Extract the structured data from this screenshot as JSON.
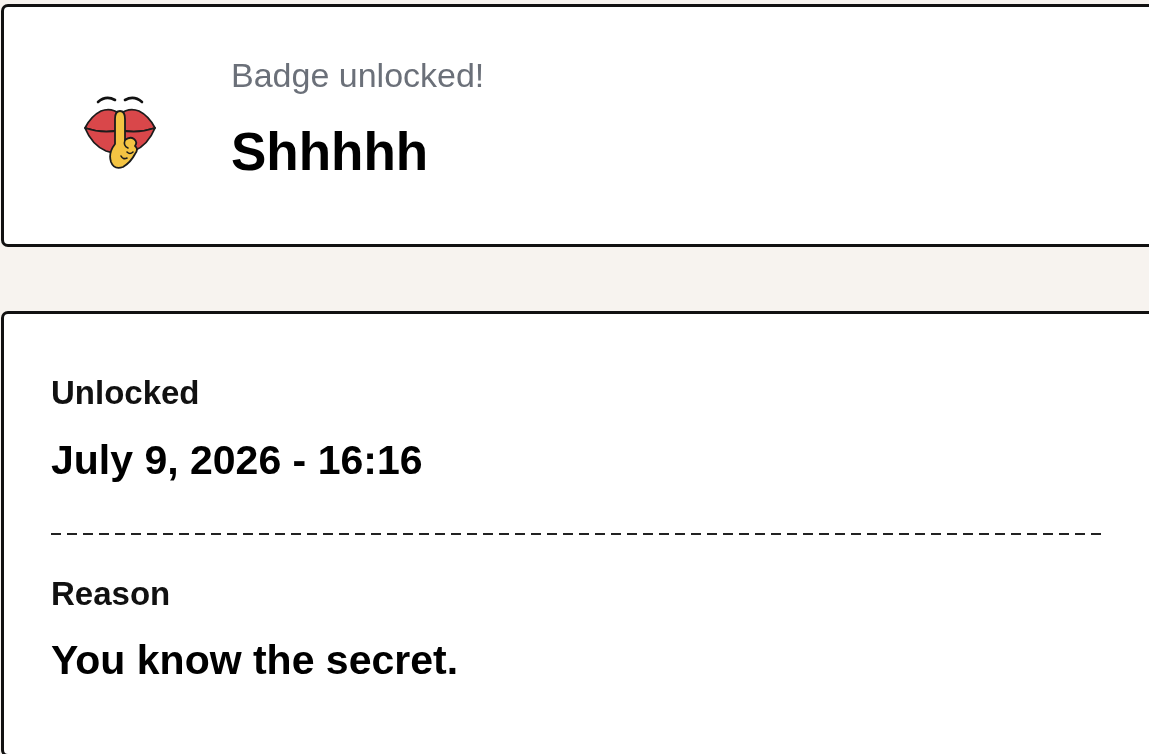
{
  "badge_notice": {
    "caption": "Badge unlocked!",
    "title": "Shhhhh"
  },
  "details": [
    {
      "label": "Unlocked",
      "value": "July 9, 2026 - 16:16"
    },
    {
      "label": "Reason",
      "value": "You know the secret."
    }
  ]
}
